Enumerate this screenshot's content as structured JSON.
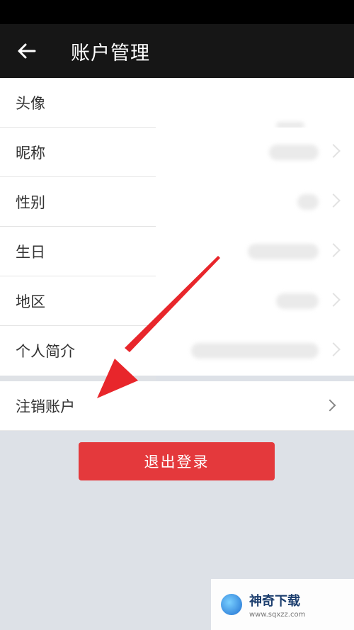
{
  "app_bar": {
    "back_icon": "arrow-left-icon",
    "title": "账户管理"
  },
  "rows": [
    {
      "label": "头像"
    },
    {
      "label": "昵称"
    },
    {
      "label": "性别"
    },
    {
      "label": "生日"
    },
    {
      "label": "地区"
    },
    {
      "label": "个人简介"
    }
  ],
  "cancel_account": {
    "label": "注销账户",
    "icon": "chevron-right-icon"
  },
  "logout_button": {
    "label": "退出登录",
    "color": "#e4393c"
  },
  "annotation_arrow": {
    "color": "#e8262b"
  },
  "watermark": {
    "title": "神奇下载",
    "url": "www.sqxzz.com"
  }
}
